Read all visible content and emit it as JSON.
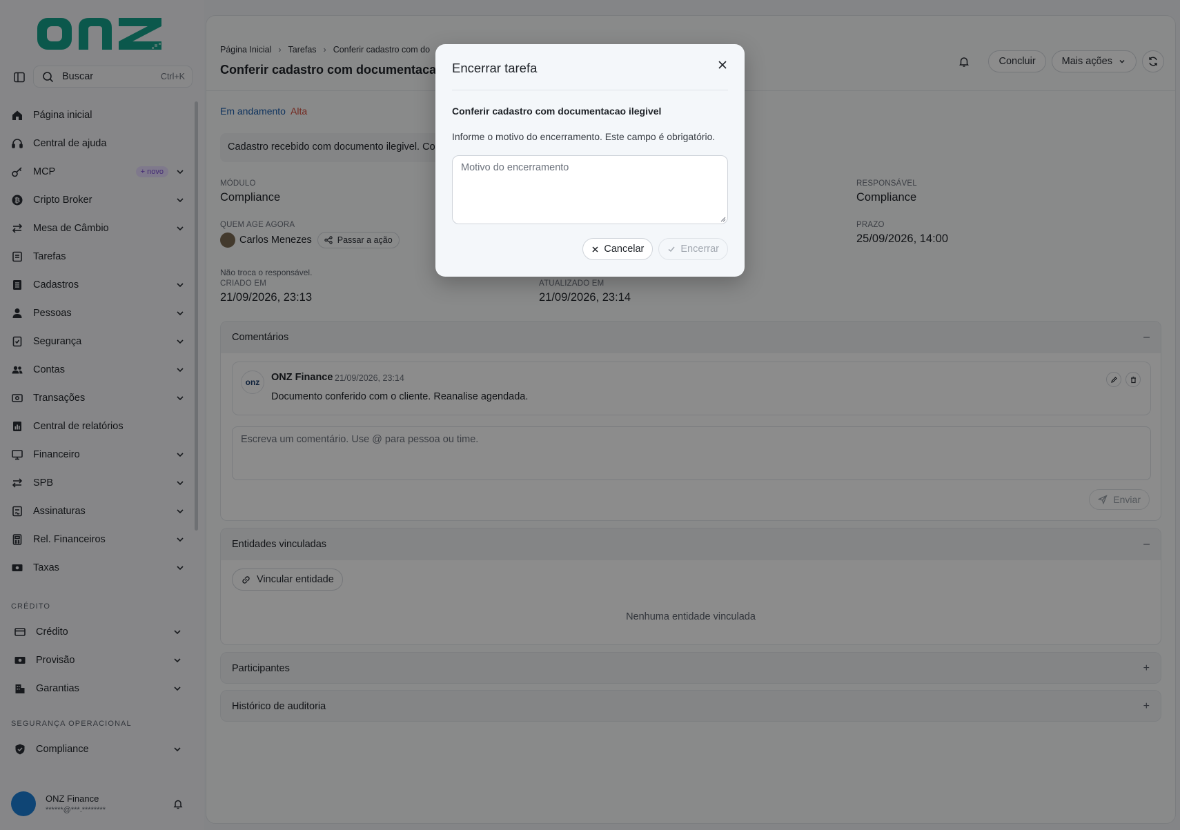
{
  "sidebar": {
    "logo_text": "onz",
    "search": {
      "label": "Buscar",
      "shortcut": "Ctrl+K"
    },
    "items": [
      {
        "label": "Página inicial",
        "icon": "home-icon"
      },
      {
        "label": "Central de ajuda",
        "icon": "headset-icon"
      },
      {
        "label": "MCP",
        "icon": "key-icon",
        "badge": "+ novo"
      },
      {
        "label": "Cripto Broker",
        "icon": "bitcoin-icon"
      },
      {
        "label": "Mesa de Câmbio",
        "icon": "exchange-icon"
      },
      {
        "label": "Tarefas",
        "icon": "clipboard-icon"
      },
      {
        "label": "Cadastros",
        "icon": "list-icon"
      },
      {
        "label": "Pessoas",
        "icon": "person-icon"
      },
      {
        "label": "Segurança",
        "icon": "shield-doc-icon"
      },
      {
        "label": "Contas",
        "icon": "users-icon"
      },
      {
        "label": "Transações",
        "icon": "money-icon"
      },
      {
        "label": "Central de relatórios",
        "icon": "report-icon"
      },
      {
        "label": "Financeiro",
        "icon": "monitor-icon"
      },
      {
        "label": "SPB",
        "icon": "exchange-icon"
      },
      {
        "label": "Assinaturas",
        "icon": "signature-icon"
      },
      {
        "label": "Rel. Financeiros",
        "icon": "calculator-icon"
      },
      {
        "label": "Taxas",
        "icon": "cash-icon"
      }
    ],
    "credit_section": {
      "title": "CRÉDITO",
      "items": [
        {
          "label": "Crédito",
          "icon": "card-icon"
        },
        {
          "label": "Provisão",
          "icon": "cash-icon"
        },
        {
          "label": "Garantias",
          "icon": "building-icon"
        }
      ]
    },
    "security_section": {
      "title": "SEGURANÇA OPERACIONAL",
      "items": [
        {
          "label": "Compliance",
          "icon": "shield-icon"
        }
      ]
    },
    "user": {
      "name": "ONZ Finance",
      "email": "******@***.********"
    }
  },
  "header": {
    "breadcrumbs": [
      "Página Inicial",
      "Tarefas",
      "Conferir cadastro com do"
    ],
    "title": "Conferir cadastro com documentacao il",
    "actions": {
      "complete": "Concluir",
      "more": "Mais ações"
    }
  },
  "task": {
    "status": "Em andamento",
    "priority": "Alta",
    "description": "Cadastro recebido com documento ilegivel. Co",
    "fields": {
      "module": {
        "label": "MÓDULO",
        "value": "Compliance"
      },
      "responsible": {
        "label": "RESPONSÁVEL",
        "value": "Compliance"
      },
      "actor": {
        "label": "QUEM AGE AGORA",
        "value": "Carlos Menezes",
        "action": "Passar a ação",
        "hint": "Não troca o responsável."
      },
      "deadline": {
        "label": "PRAZO",
        "value": "25/09/2026, 14:00"
      },
      "created": {
        "label": "CRIADO EM",
        "value": "21/09/2026, 23:13"
      },
      "updated": {
        "label": "ATUALIZADO EM",
        "value": "21/09/2026, 23:14"
      }
    }
  },
  "comments": {
    "title": "Comentários",
    "collapse_sign": "–",
    "items": [
      {
        "author": "ONZ Finance",
        "avatar": "onz",
        "date": "21/09/2026, 23:14",
        "text": "Documento conferido com o cliente. Reanalise agendada."
      }
    ],
    "placeholder": "Escreva um comentário. Use @ para pessoa ou time.",
    "send": "Enviar"
  },
  "entities": {
    "title": "Entidades vinculadas",
    "collapse_sign": "–",
    "link_button": "Vincular entidade",
    "empty": "Nenhuma entidade vinculada"
  },
  "participants": {
    "title": "Participantes",
    "expand_sign": "+"
  },
  "audit": {
    "title": "Histórico de auditoria",
    "expand_sign": "+"
  },
  "modal": {
    "title": "Encerrar tarefa",
    "task_name": "Conferir cadastro com documentacao ilegivel",
    "help": "Informe o motivo do encerramento. Este campo é obrigatório.",
    "placeholder": "Motivo do encerramento",
    "cancel": "Cancelar",
    "confirm": "Encerrar"
  },
  "colors": {
    "brand": "#14a08a",
    "accent_link": "#1a5dab",
    "priority_high": "#d24a3a",
    "badge_purple": "#7a4fd3"
  }
}
